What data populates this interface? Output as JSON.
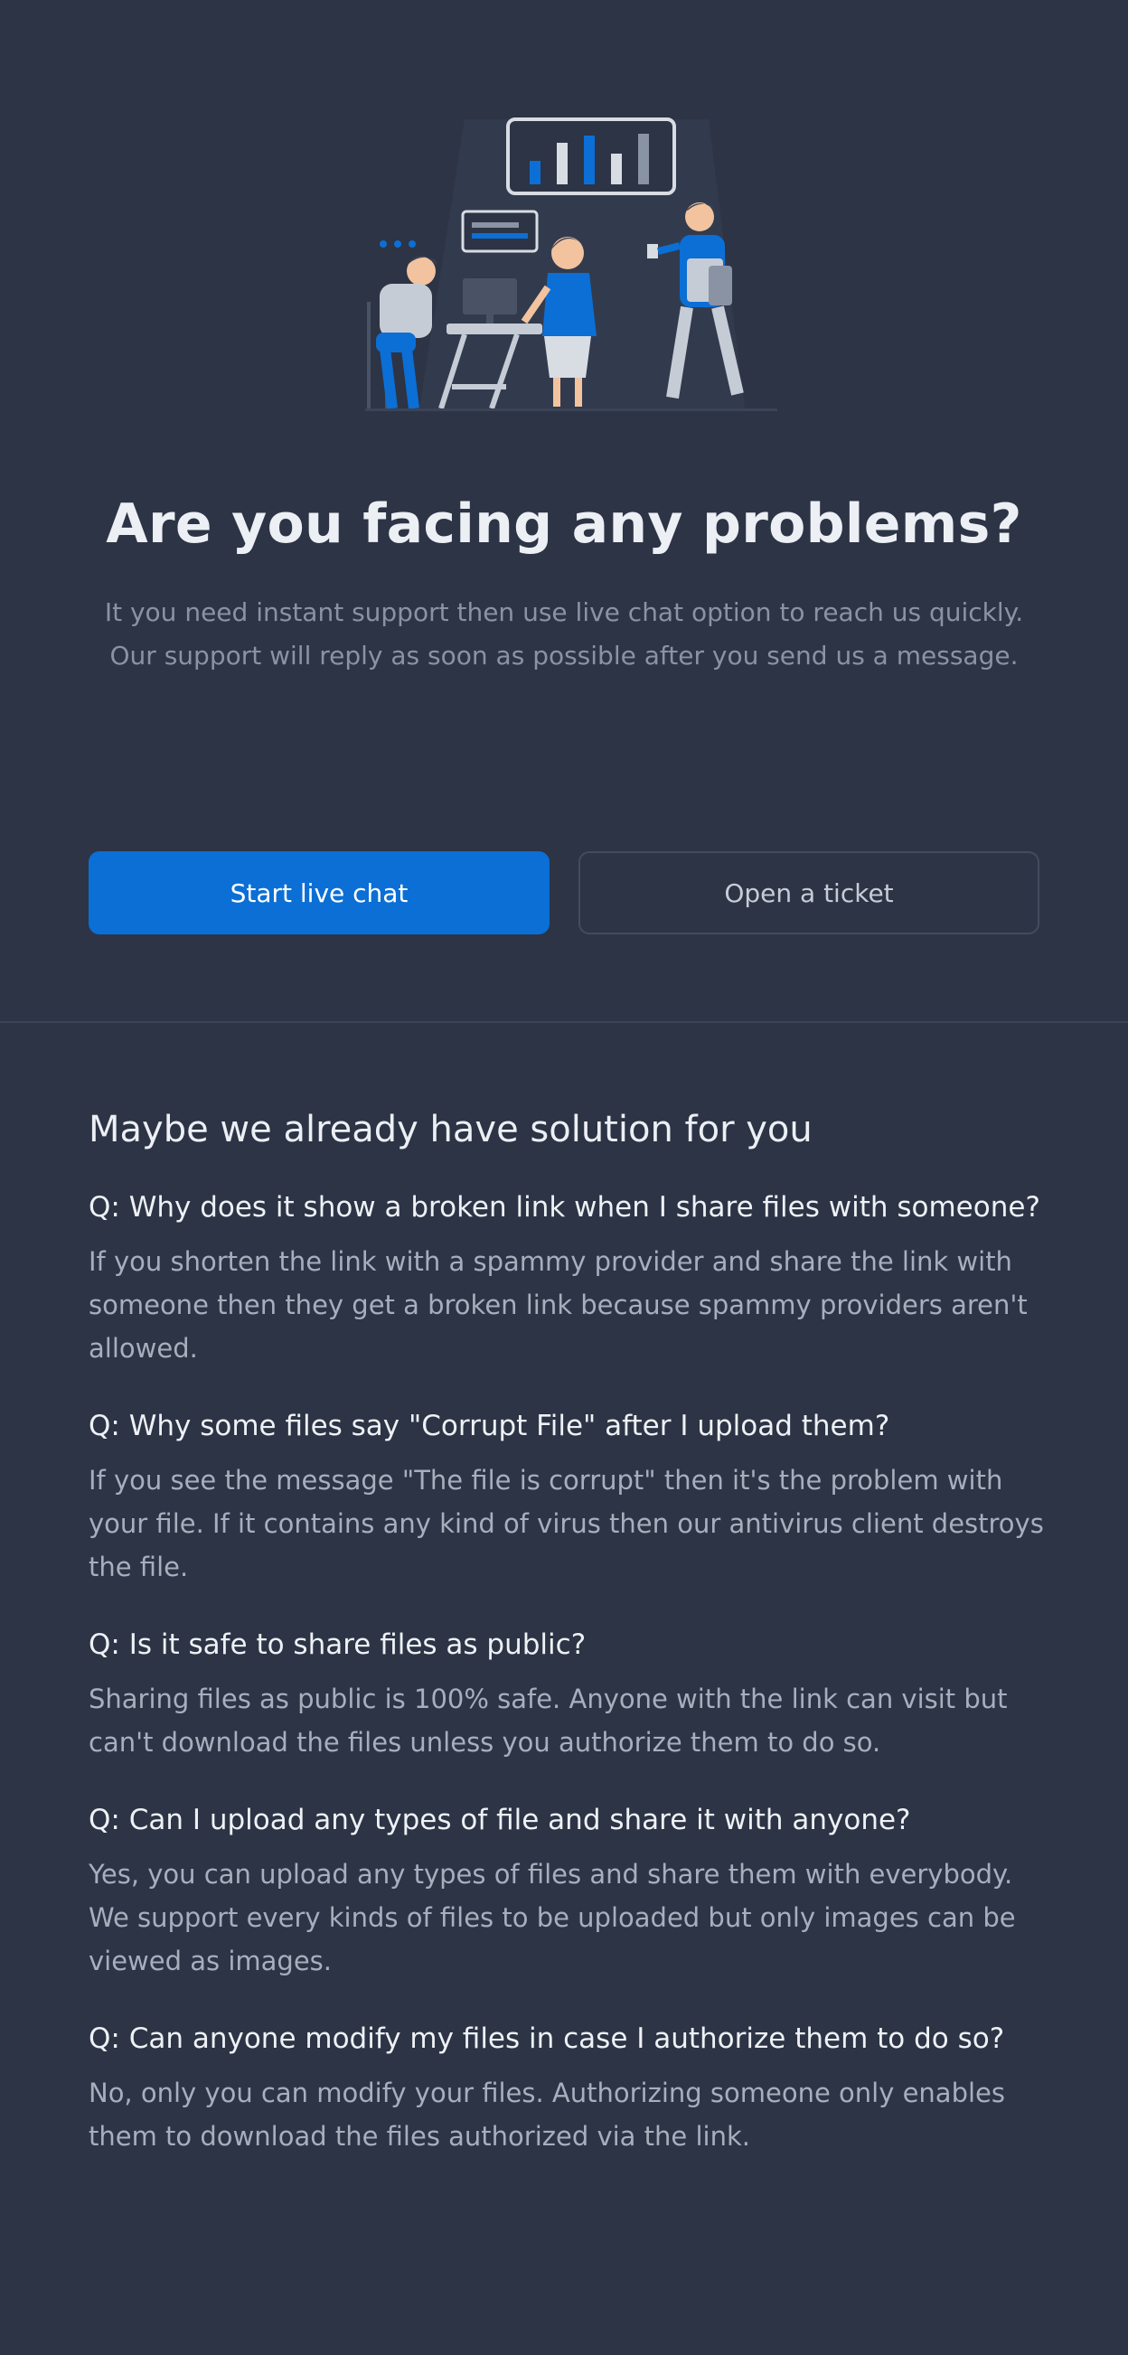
{
  "colors": {
    "background": "#2c3445",
    "primary": "#0b6fd6",
    "text_muted": "#8a93a4"
  },
  "hero": {
    "illustration": "support-team-illustration",
    "title": "Are you facing any problems?",
    "description_line1": "It you need instant support then use live chat option to reach us quickly.",
    "description_line2": "Our support will reply as soon as possible after you send us a message."
  },
  "actions": {
    "live_chat_label": "Start live chat",
    "ticket_label": "Open a ticket"
  },
  "faq": {
    "title": "Maybe we already have solution for you",
    "items": [
      {
        "question": "Q: Why does it show a broken link when I share files with someone?",
        "answer": "If you shorten the link with a spammy provider and share the link with someone then they get a broken link because spammy providers aren't allowed."
      },
      {
        "question": "Q: Why some files say \"Corrupt File\" after I upload them?",
        "answer": "If you see the message \"The file is corrupt\" then it's the problem with your file. If it contains any kind of virus then our antivirus client destroys the file."
      },
      {
        "question": "Q: Is it safe to share files as public?",
        "answer": "Sharing files as public is 100% safe. Anyone with the link can visit but can't download the files unless you authorize them to do so."
      },
      {
        "question": "Q: Can I upload any types of file and share it with anyone?",
        "answer": "Yes, you can upload any types of files and share them with everybody. We support every kinds of files to be uploaded but only images can be viewed as images."
      },
      {
        "question": "Q: Can anyone modify my files in case I authorize them to do so?",
        "answer": "No, only you can modify your files. Authorizing someone only enables them to download the files authorized via the link."
      }
    ]
  }
}
